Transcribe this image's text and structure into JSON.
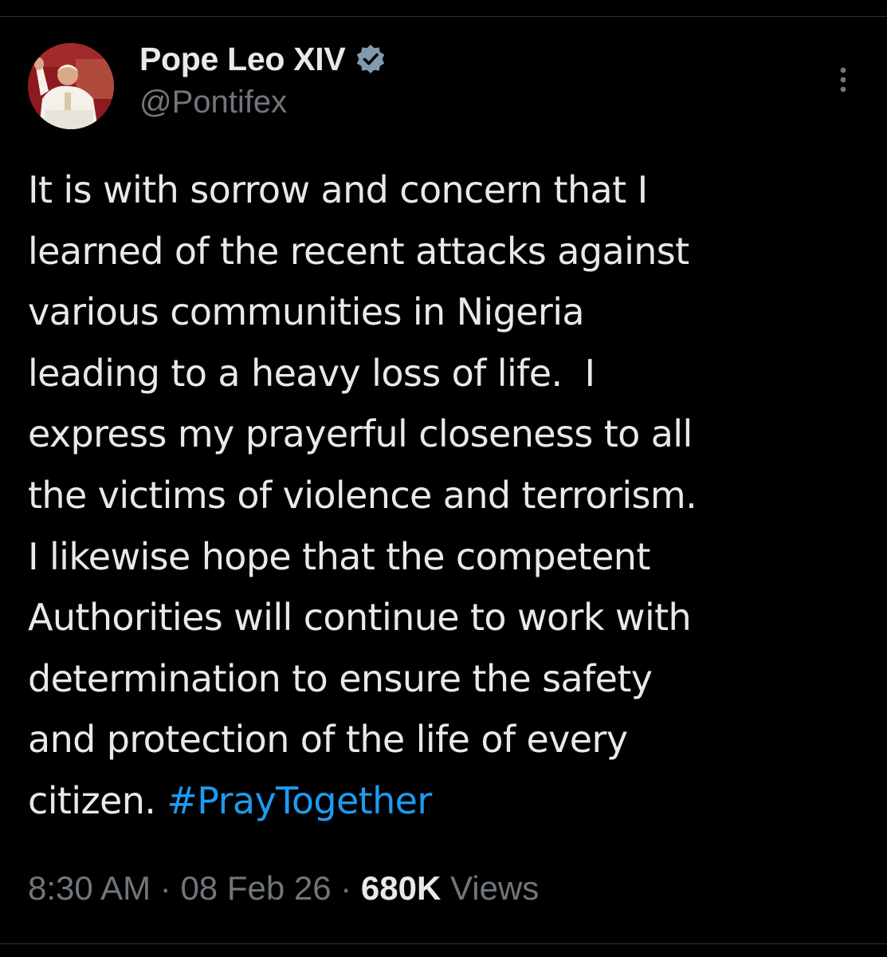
{
  "author": {
    "display_name": "Pope Leo XIV",
    "handle": "@Pontifex",
    "verified": true
  },
  "tweet": {
    "lines": [
      "It is with sorrow and concern that I",
      "learned of the recent attacks against",
      "various communities in Nigeria",
      "leading to a heavy loss of life.  I",
      "express my prayerful closeness to all",
      "the victims of violence and terrorism.",
      "I likewise hope that the competent",
      "Authorities will continue to work with",
      "determination to ensure the safety",
      "and protection of the life of every"
    ],
    "last_line_text": "citizen. ",
    "hashtag": "#PrayTogether"
  },
  "meta": {
    "time": "8:30 AM",
    "separator": " · ",
    "date": "08 Feb 26",
    "views_count": "680K",
    "views_label": " Views"
  },
  "icons": {
    "verified": "verified-badge-icon",
    "more": "more-vertical-icon"
  },
  "colors": {
    "background": "#000000",
    "text_primary": "#e7e9ea",
    "text_secondary": "#71767b",
    "link": "#1d9bf0",
    "verified_badge": "#829aab"
  }
}
